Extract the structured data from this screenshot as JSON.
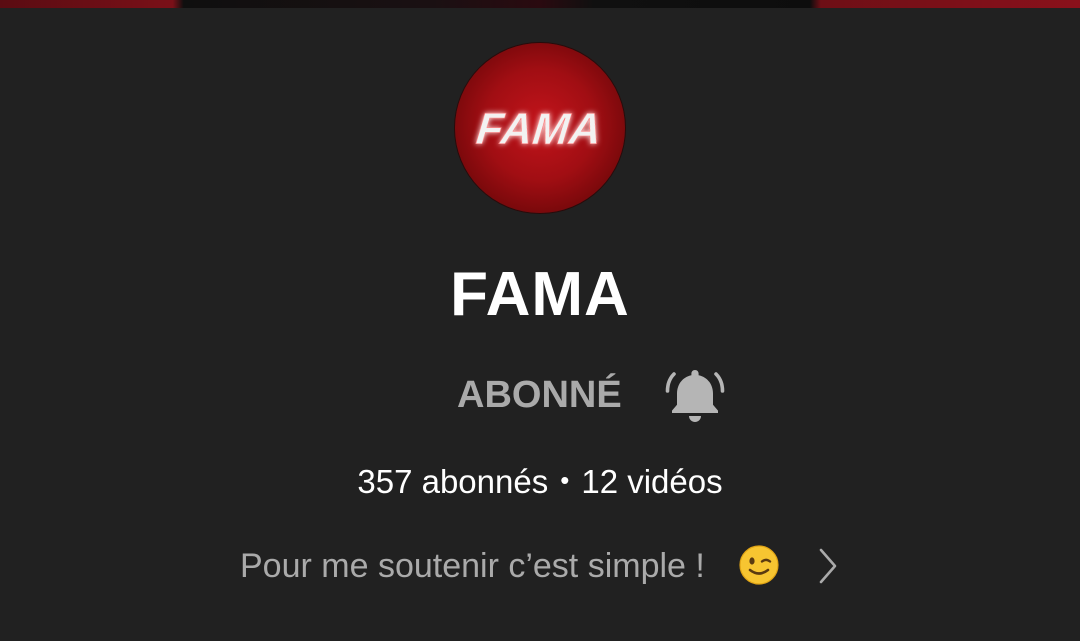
{
  "channel": {
    "name": "FAMA",
    "avatar_logo_text": "FAMA",
    "subscribe_label": "ABONNÉ",
    "subscribers": "357 abonnés",
    "separator": "•",
    "videos": "12 vidéos",
    "description": "Pour me soutenir c’est simple !"
  },
  "icons": {
    "notification": "bell-ringing-icon",
    "emoji": "winking-face-icon",
    "more": "chevron-right-icon"
  },
  "colors": {
    "background": "#212121",
    "accent_red": "#b3121a",
    "muted_text": "#aaaaaa",
    "primary_text": "#ffffff"
  }
}
